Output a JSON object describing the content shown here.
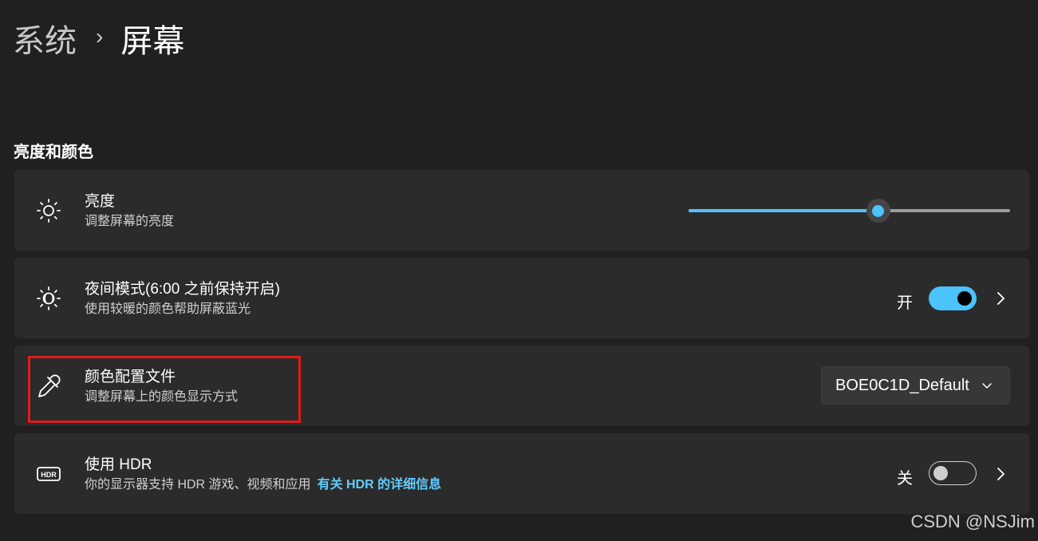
{
  "breadcrumb": {
    "parent": "系统",
    "separator": "›",
    "current": "屏幕"
  },
  "section": {
    "title": "亮度和颜色"
  },
  "brightness": {
    "title": "亮度",
    "subtitle": "调整屏幕的亮度",
    "icon": "sun-icon",
    "level": 0.59
  },
  "night_mode": {
    "title": "夜间模式(6:00 之前保持开启)",
    "subtitle": "使用较暖的颜色帮助屏蔽蓝光",
    "icon": "night-light-icon",
    "toggle_label": "开",
    "toggle_state": "on"
  },
  "color_profile": {
    "title": "颜色配置文件",
    "subtitle": "调整屏幕上的颜色显示方式",
    "icon": "eyedropper-icon",
    "dropdown_value": "BOE0C1D_Default"
  },
  "hdr": {
    "title": "使用 HDR",
    "subtitle": "你的显示器支持 HDR 游戏、视频和应用",
    "link": "有关 HDR 的详细信息",
    "icon": "hdr-icon",
    "toggle_label": "关",
    "toggle_state": "off"
  },
  "watermark": "CSDN @NSJim",
  "colors": {
    "accent": "#4cc2ff",
    "link": "#60cdff",
    "background": "#202020",
    "card": "#2b2b2b",
    "highlight": "#e31b1b"
  }
}
